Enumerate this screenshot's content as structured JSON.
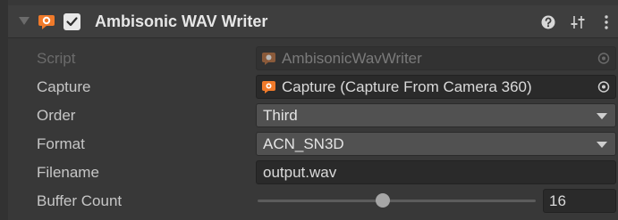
{
  "component": {
    "title": "Ambisonic WAV Writer",
    "enabled": true,
    "header_icons": [
      "foldout-arrow-icon",
      "audio-speech-bubble-icon",
      "checkbox-icon",
      "help-icon",
      "presets-icon",
      "context-menu-icon"
    ]
  },
  "fields": {
    "script": {
      "label": "Script",
      "value": "AmbisonicWavWriter"
    },
    "capture": {
      "label": "Capture",
      "value": "Capture (Capture From Camera 360)"
    },
    "order": {
      "label": "Order",
      "value": "Third"
    },
    "format": {
      "label": "Format",
      "value": "ACN_SN3D"
    },
    "filename": {
      "label": "Filename",
      "value": "output.wav"
    },
    "buffer_count": {
      "label": "Buffer Count",
      "value": "16",
      "slider_fraction": 0.45
    }
  },
  "colors": {
    "panel_bg": "#383838",
    "header_bg": "#3e3e3e",
    "icon_orange": "#f07a2a",
    "field_bg": "#2a2a2a",
    "dropdown_bg": "#515151"
  }
}
